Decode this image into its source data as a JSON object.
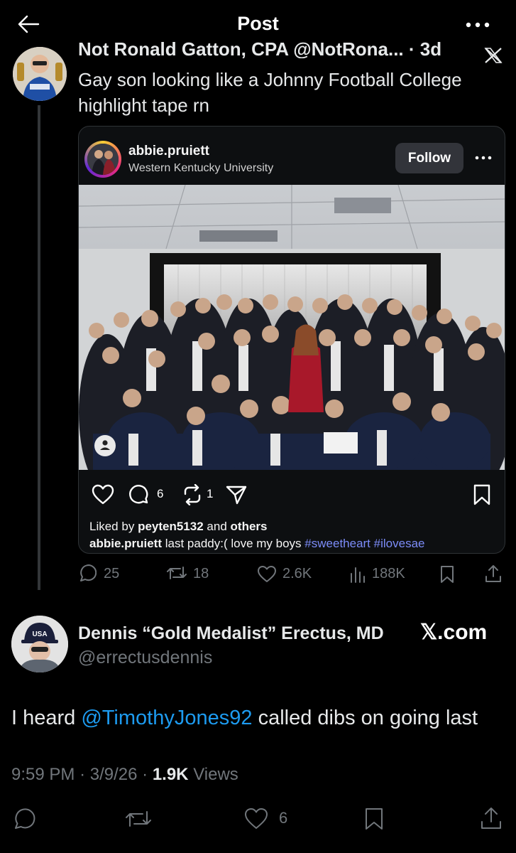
{
  "header": {
    "title": "Post"
  },
  "quoted": {
    "author_line": "Not Ronald Gatton, CPA @NotRona... · 3d",
    "text_line1": "Gay son looking like a Johnny Football College",
    "text_line2": "highlight tape rn",
    "ig": {
      "username": "abbie.pruiett",
      "location": "Western Kentucky University",
      "follow_label": "Follow",
      "comments": "6",
      "reposts": "1",
      "liked_prefix": "Liked by",
      "liked_user": "peyten5132",
      "liked_and": "and",
      "liked_others": "others",
      "caption_user": "abbie.pruiett",
      "caption_text": "last paddy:( love my boys",
      "hashtag1": "#sweetheart",
      "hashtag2": "#ilovesae"
    },
    "stats": {
      "replies": "25",
      "reposts": "18",
      "likes": "2.6K",
      "views": "188K"
    }
  },
  "reply": {
    "name": "Dennis “Gold Medalist” Erectus, MD",
    "handle": "@errectusdennis",
    "watermark": "𝕏.com",
    "text_before": "I heard",
    "mention": "@TimothyJones92",
    "text_after": "called dibs on going last",
    "time": "9:59 PM",
    "date": "3/9/26",
    "views_count": "1.9K",
    "views_label": "Views",
    "likes": "6"
  },
  "colors": {
    "accent_blue": "#1d9bf0",
    "ig_hashtag": "#7c8cf8",
    "muted": "#71767b"
  }
}
